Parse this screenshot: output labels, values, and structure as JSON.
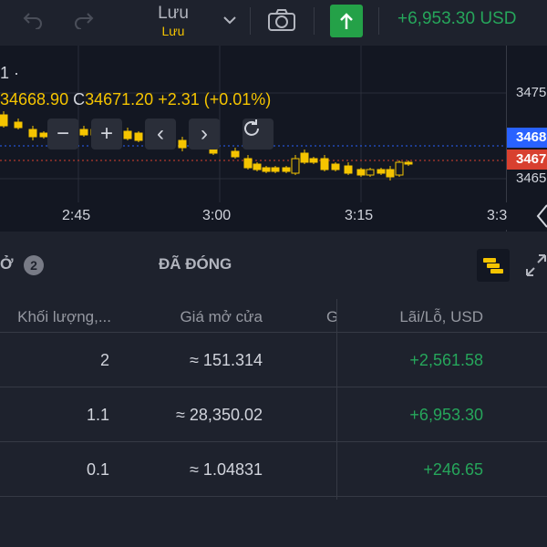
{
  "toolbar": {
    "save_label": "Lưu",
    "save_sublabel": "Lưu",
    "balance": "+6,953.30 USD"
  },
  "chart": {
    "legend_title": "1 ·",
    "ohlc_open_fragment": "34668.90",
    "ohlc_close_label": "C",
    "ohlc_close": "34671.20",
    "ohlc_change": "+2.31 (+0.01%)",
    "price_ticks": [
      "3475",
      "3465"
    ],
    "price_badge_blue": "3468",
    "price_badge_red": "3467",
    "time_ticks": [
      "2:45",
      "3:00",
      "3:15",
      "3:3"
    ],
    "colors": {
      "up": "#f5c400",
      "down": "#f5c400",
      "blue_badge": "#2962ff",
      "red_badge": "#d8402f"
    },
    "zoom_out_label": "−",
    "zoom_in_label": "+",
    "scroll_left_label": "‹",
    "scroll_right_label": "›"
  },
  "tabs": {
    "open_label": "Ở",
    "open_count": "2",
    "closed_label": "ĐÃ ĐÓNG"
  },
  "table": {
    "headers": {
      "volume": "Khối lượng,...",
      "open_price": "Giá mở cửa",
      "cut": "G",
      "pnl": "Lãi/Lỗ, USD"
    },
    "rows": [
      {
        "volume": "2",
        "open_price": "≈ 151.314",
        "pnl": "+2,561.58"
      },
      {
        "volume": "1.1",
        "open_price": "≈ 28,350.02",
        "pnl": "+6,953.30"
      },
      {
        "volume": "0.1",
        "open_price": "≈ 1.04831",
        "pnl": "+246.65"
      }
    ]
  }
}
